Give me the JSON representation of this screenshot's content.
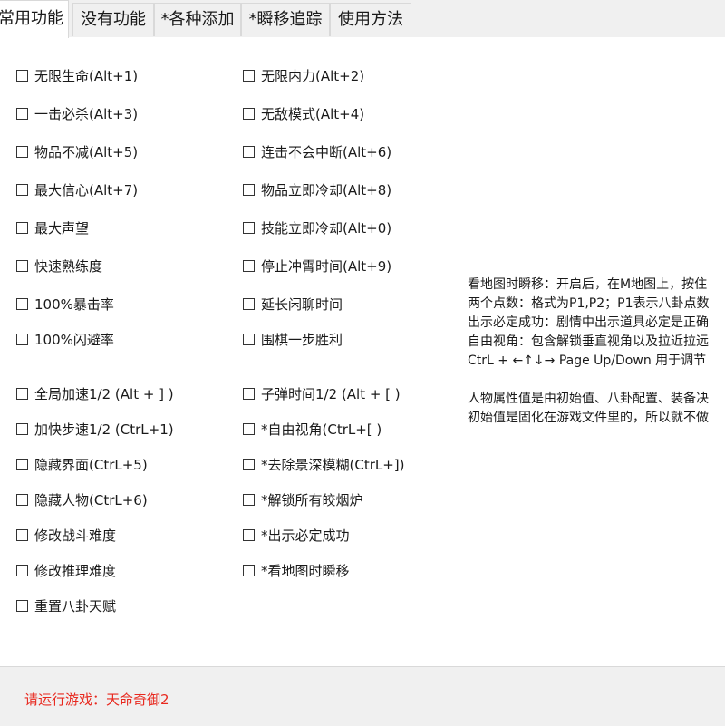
{
  "tabs": [
    {
      "label": "常用功能",
      "active": true
    },
    {
      "label": "没有功能",
      "active": false
    },
    {
      "label": "*各种添加",
      "active": false
    },
    {
      "label": "*瞬移追踪",
      "active": false
    },
    {
      "label": "使用方法",
      "active": false
    }
  ],
  "options": {
    "left": [
      {
        "label": "无限生命(Alt+1)",
        "checked": false
      },
      {
        "label": "一击必杀(Alt+3)",
        "checked": false
      },
      {
        "label": "物品不减(Alt+5)",
        "checked": false
      },
      {
        "label": "最大信心(Alt+7)",
        "checked": false
      },
      {
        "label": "最大声望",
        "checked": false
      },
      {
        "label": "快速熟练度",
        "checked": false
      },
      {
        "label": "100%暴击率",
        "checked": false
      },
      {
        "label": "100%闪避率",
        "checked": false
      },
      {
        "label": "全局加速1/2 (Alt + ] )",
        "checked": false
      },
      {
        "label": "加快步速1/2 (CtrL+1)",
        "checked": false
      },
      {
        "label": "隐藏界面(CtrL+5)",
        "checked": false
      },
      {
        "label": "隐藏人物(CtrL+6)",
        "checked": false
      },
      {
        "label": "修改战斗难度",
        "checked": false
      },
      {
        "label": "修改推理难度",
        "checked": false
      },
      {
        "label": "重置八卦天赋",
        "checked": false
      }
    ],
    "right": [
      {
        "label": "无限内力(Alt+2)",
        "checked": false
      },
      {
        "label": "无敌模式(Alt+4)",
        "checked": false
      },
      {
        "label": "连击不会中断(Alt+6)",
        "checked": false
      },
      {
        "label": "物品立即冷却(Alt+8)",
        "checked": false
      },
      {
        "label": "技能立即冷却(Alt+0)",
        "checked": false
      },
      {
        "label": "停止冲霄时间(Alt+9)",
        "checked": false
      },
      {
        "label": "延长闲聊时间",
        "checked": false
      },
      {
        "label": "围棋一步胜利",
        "checked": false
      },
      {
        "label": "子弹时间1/2 (Alt + [ )",
        "checked": false
      },
      {
        "label": "*自由视角(CtrL+[ )",
        "checked": false
      },
      {
        "label": "*去除景深模糊(CtrL+])",
        "checked": false
      },
      {
        "label": "*解锁所有皎烟炉",
        "checked": false
      },
      {
        "label": "*出示必定成功",
        "checked": false
      },
      {
        "label": "*看地图时瞬移",
        "checked": false
      }
    ]
  },
  "info": {
    "lines": [
      "看地图时瞬移：开启后，在M地图上，按住",
      "两个点数：格式为P1,P2；P1表示八卦点数",
      "出示必定成功：剧情中出示道具必定是正确",
      "自由视角：包含解锁垂直视角以及拉近拉远",
      "CtrL + ←↑↓→ Page Up/Down 用于调节",
      "",
      "人物属性值是由初始值、八卦配置、装备决",
      "初始值是固化在游戏文件里的，所以就不做"
    ]
  },
  "status": {
    "text": "请运行游戏：天命奇御2",
    "color": "#e8281e"
  }
}
